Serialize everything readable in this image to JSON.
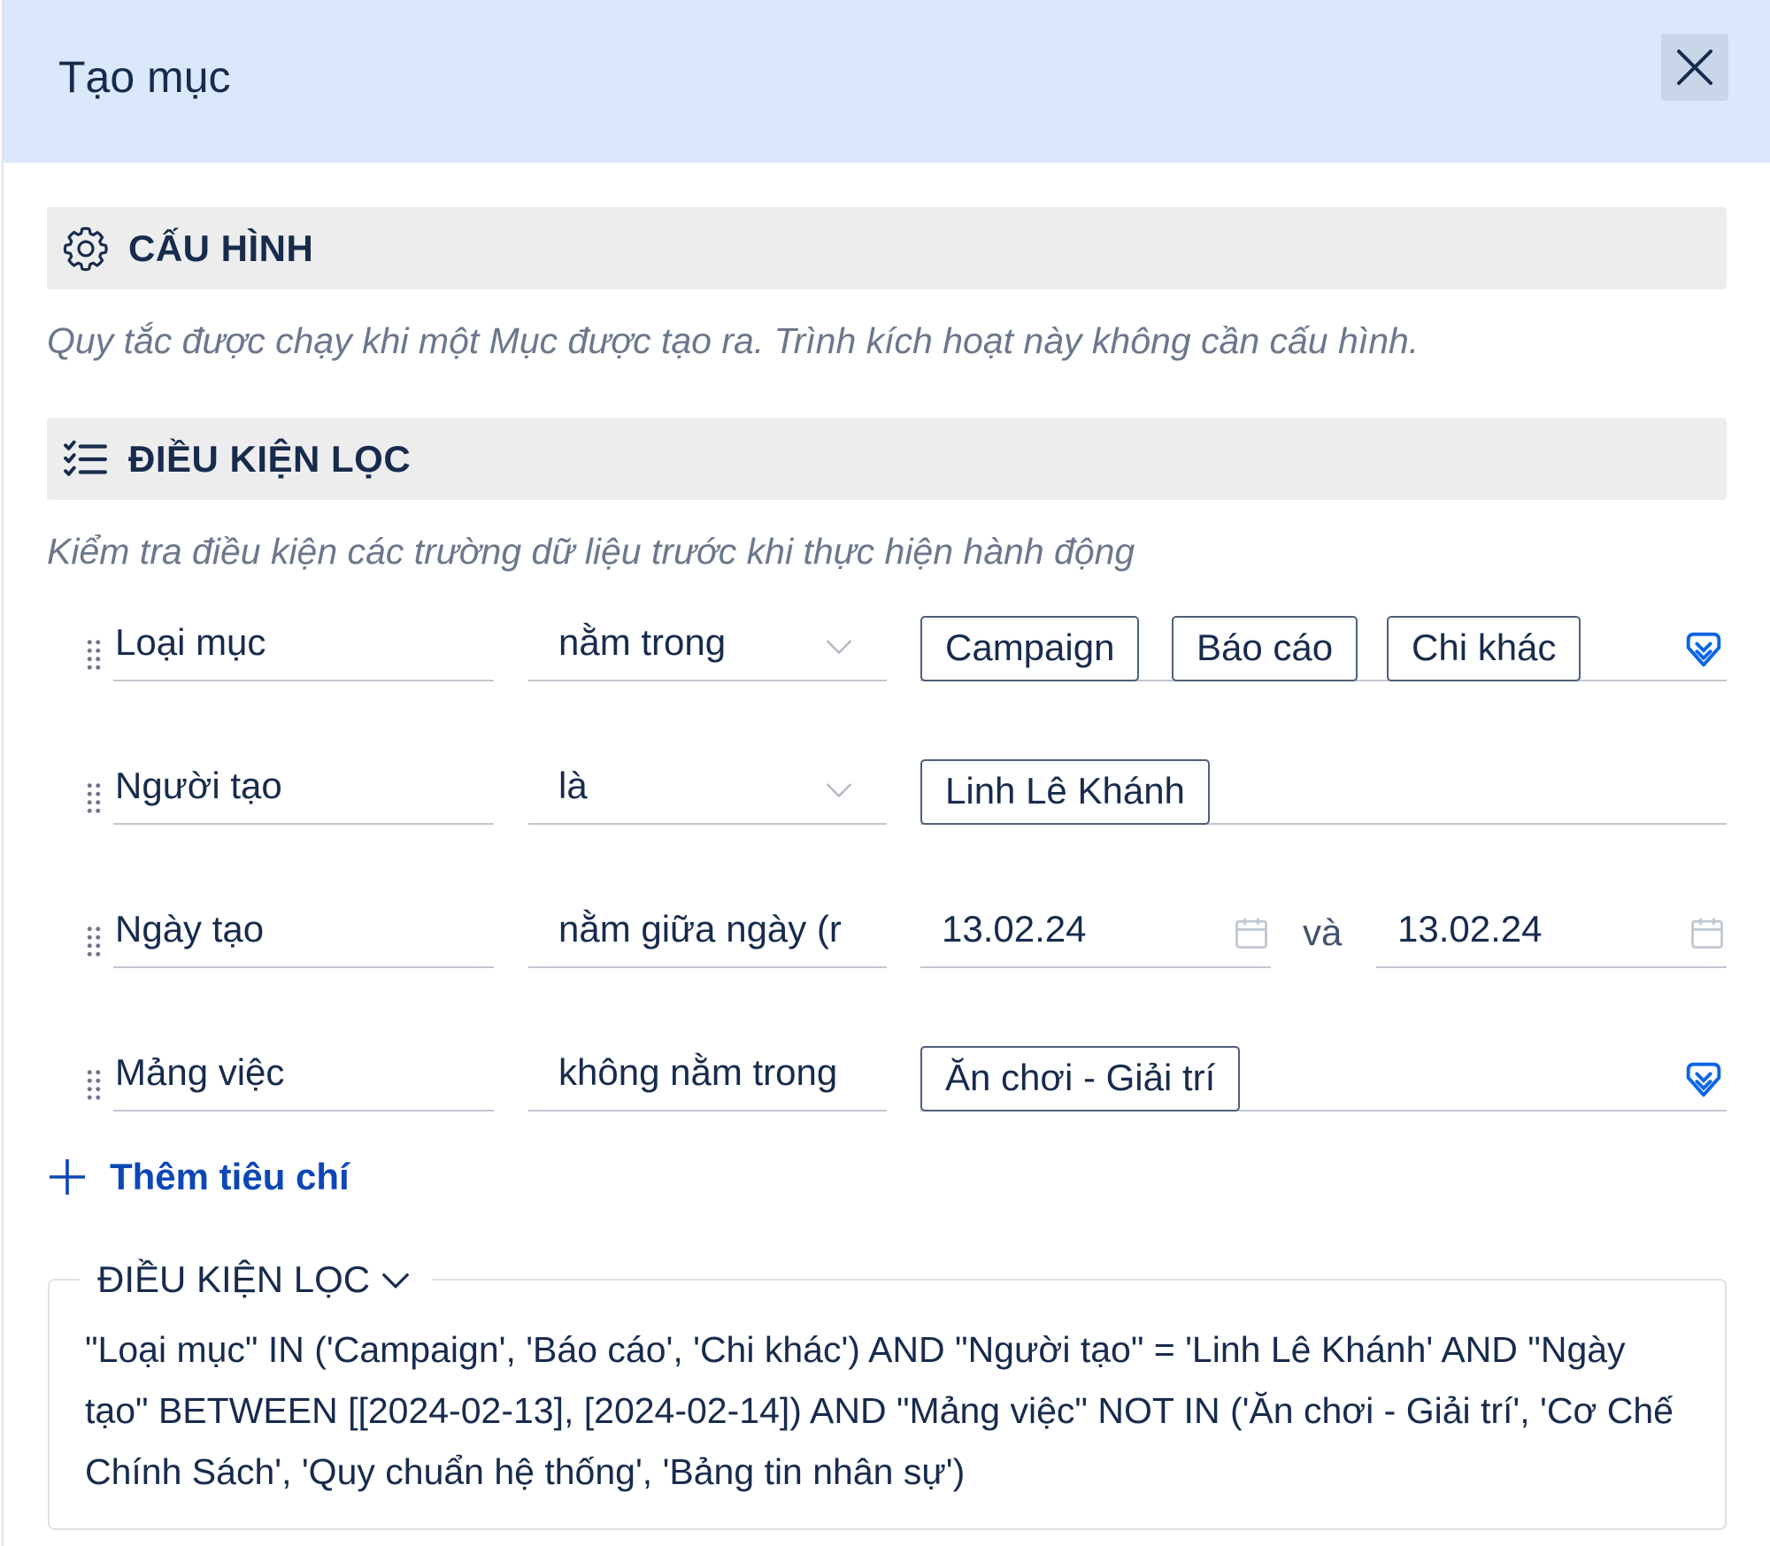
{
  "dialog": {
    "title": "Tạo mục"
  },
  "config_section": {
    "title": "CẤU HÌNH",
    "icon": "gear-icon",
    "description": "Quy tắc được chạy khi một Mục được tạo ra. Trình kích hoạt này không cần cấu hình."
  },
  "filter_section": {
    "title": "ĐIỀU KIỆN LỌC",
    "icon": "checklist-icon",
    "description": "Kiểm tra điều kiện các trường dữ liệu trước khi thực hiện hành động"
  },
  "rows": [
    {
      "field": "Loại mục",
      "operator": "nằm trong",
      "tags": [
        "Campaign",
        "Báo cáo",
        "Chi khác"
      ]
    },
    {
      "field": "Người tạo",
      "operator": "là",
      "tags": [
        "Linh Lê Khánh"
      ]
    },
    {
      "field": "Ngày tạo",
      "operator": "nằm giữa ngày (r",
      "date_from": "13.02.24",
      "joiner": "và",
      "date_to": "13.02.24"
    },
    {
      "field": "Mảng việc",
      "operator": "không nằm trong",
      "tags": [
        "Ăn chơi - Giải trí"
      ]
    }
  ],
  "add_criteria": {
    "label": "Thêm tiêu chí"
  },
  "query_box": {
    "legend": "ĐIỀU KIỆN LỌC",
    "text": "\"Loại mục\" IN ('Campaign', 'Báo cáo', 'Chi khác') AND \"Người tạo\" = 'Linh Lê Khánh' AND \"Ngày tạo\" BETWEEN [[2024-02-13], [2024-02-14]) AND \"Mảng việc\" NOT IN ('Ăn chơi - Giải trí', 'Cơ Chế Chính Sách', 'Quy chuẩn hệ thống', 'Bảng tin nhân sự')"
  },
  "colors": {
    "header_bg": "#dbe8fc",
    "section_bg": "#ededed",
    "link": "#0c47b7",
    "text": "#172b4d",
    "muted": "#6b778c"
  }
}
